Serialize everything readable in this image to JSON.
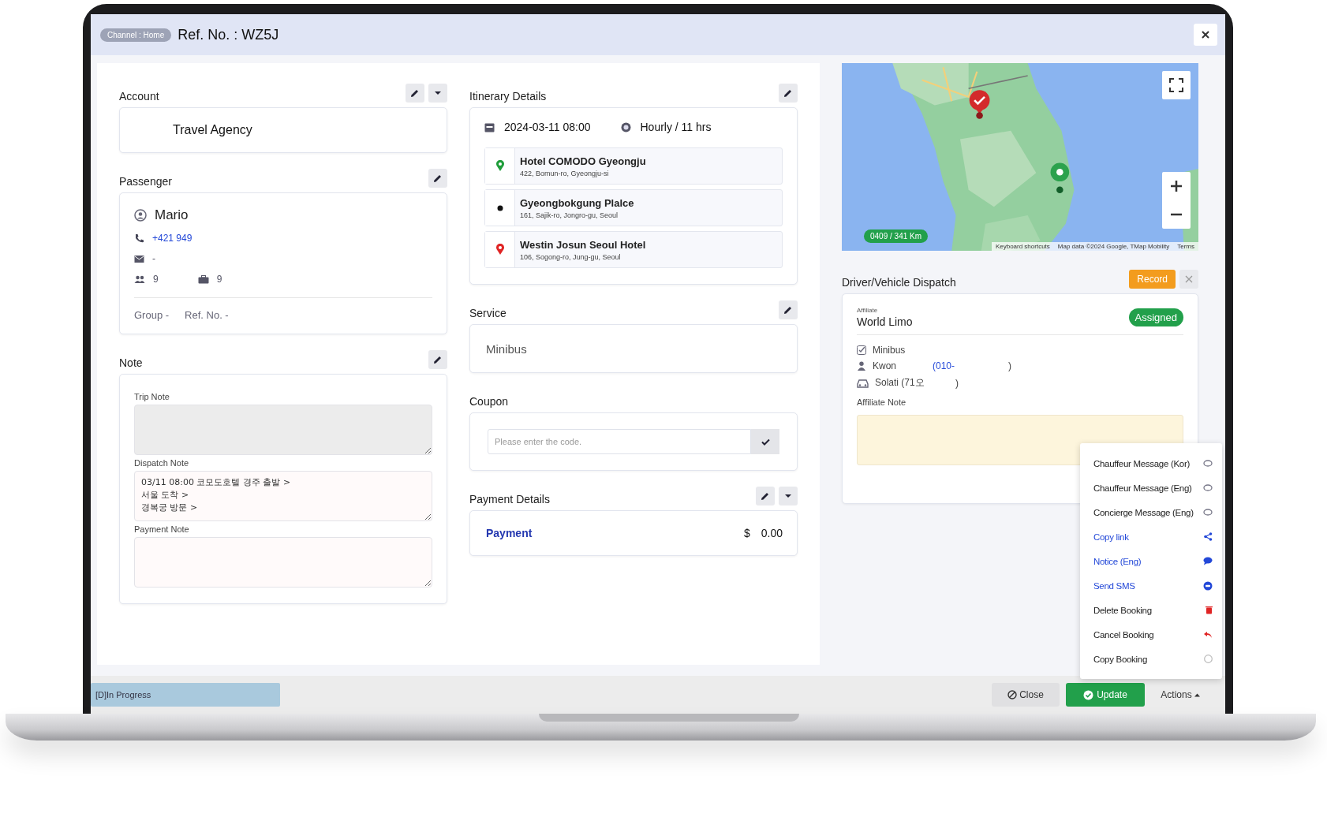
{
  "header": {
    "channel": "Channel : Home",
    "title": "Ref. No. : WZ5J"
  },
  "account": {
    "title": "Account",
    "name": "Travel Agency"
  },
  "passenger": {
    "title": "Passenger",
    "name": "Mario",
    "phone": "+421 949",
    "email": "-",
    "pax": "9",
    "luggage": "9",
    "group_label": "Group",
    "group": "-",
    "ref_label": "Ref. No.",
    "ref": "-"
  },
  "note": {
    "title": "Note",
    "fields": [
      {
        "label": "Trip Note",
        "kind": "disabled"
      },
      {
        "label": "Dispatch Note",
        "kind": "text",
        "lines": [
          "03/11 08:00 코모도호텔 경주 출발 >",
          "서울 도착 >",
          "경복궁 방문 >"
        ]
      },
      {
        "label": "Payment Note",
        "kind": "text"
      }
    ]
  },
  "itinerary": {
    "title": "Itinerary Details",
    "date": "2024-03-11 08:00",
    "duration": "Hourly / 11 hrs",
    "stops": [
      {
        "kind": "pickup",
        "name": "Hotel COMODO Gyeongju",
        "address": "422, Bomun-ro, Gyeongju-si"
      },
      {
        "kind": "waypoint",
        "name": "Gyeongbokgung Plalce",
        "address": "161, Sajik-ro, Jongro-gu, Seoul"
      },
      {
        "kind": "dropoff",
        "name": "Westin Josun Seoul Hotel",
        "address": "106, Sogong-ro, Jung-gu, Seoul"
      }
    ]
  },
  "service": {
    "title": "Service",
    "value": "Minibus"
  },
  "coupon": {
    "title": "Coupon",
    "placeholder": "Please enter the code."
  },
  "payment": {
    "title": "Payment Details",
    "label": "Payment",
    "currency": "$",
    "amount": "0.00"
  },
  "map": {
    "distance": "0409 / 341 Km",
    "attribution": [
      "Keyboard shortcuts",
      "Map data ©2024 Google, TMap Mobility",
      "Terms"
    ]
  },
  "dispatch": {
    "title": "Driver/Vehicle Dispatch",
    "record": "Record",
    "affiliate_label": "Affiliate",
    "affiliate": "World Limo",
    "status": "Assigned",
    "vehicle_type": "Minibus",
    "driver": "Kwon",
    "driver_phone": "(010-",
    "driver_phone_end": ")",
    "car": "Solati (71오",
    "car_end": ")",
    "note_label": "Affiliate Note"
  },
  "actions_menu": [
    {
      "label": "Chauffeur Message (Kor)",
      "kind": "message"
    },
    {
      "label": "Chauffeur Message (Eng)",
      "kind": "message"
    },
    {
      "label": "Concierge Message (Eng)",
      "kind": "message"
    },
    {
      "label": "Copy link",
      "kind": "share"
    },
    {
      "label": "Notice (Eng)",
      "kind": "notice"
    },
    {
      "label": "Send SMS",
      "kind": "sms"
    },
    {
      "label": "Delete Booking",
      "kind": "delete"
    },
    {
      "label": "Cancel Booking",
      "kind": "cancel"
    },
    {
      "label": "Copy Booking",
      "kind": "copy"
    }
  ],
  "footer": {
    "status": "[D]In Progress",
    "close": "Close",
    "update": "Update",
    "actions": "Actions"
  }
}
